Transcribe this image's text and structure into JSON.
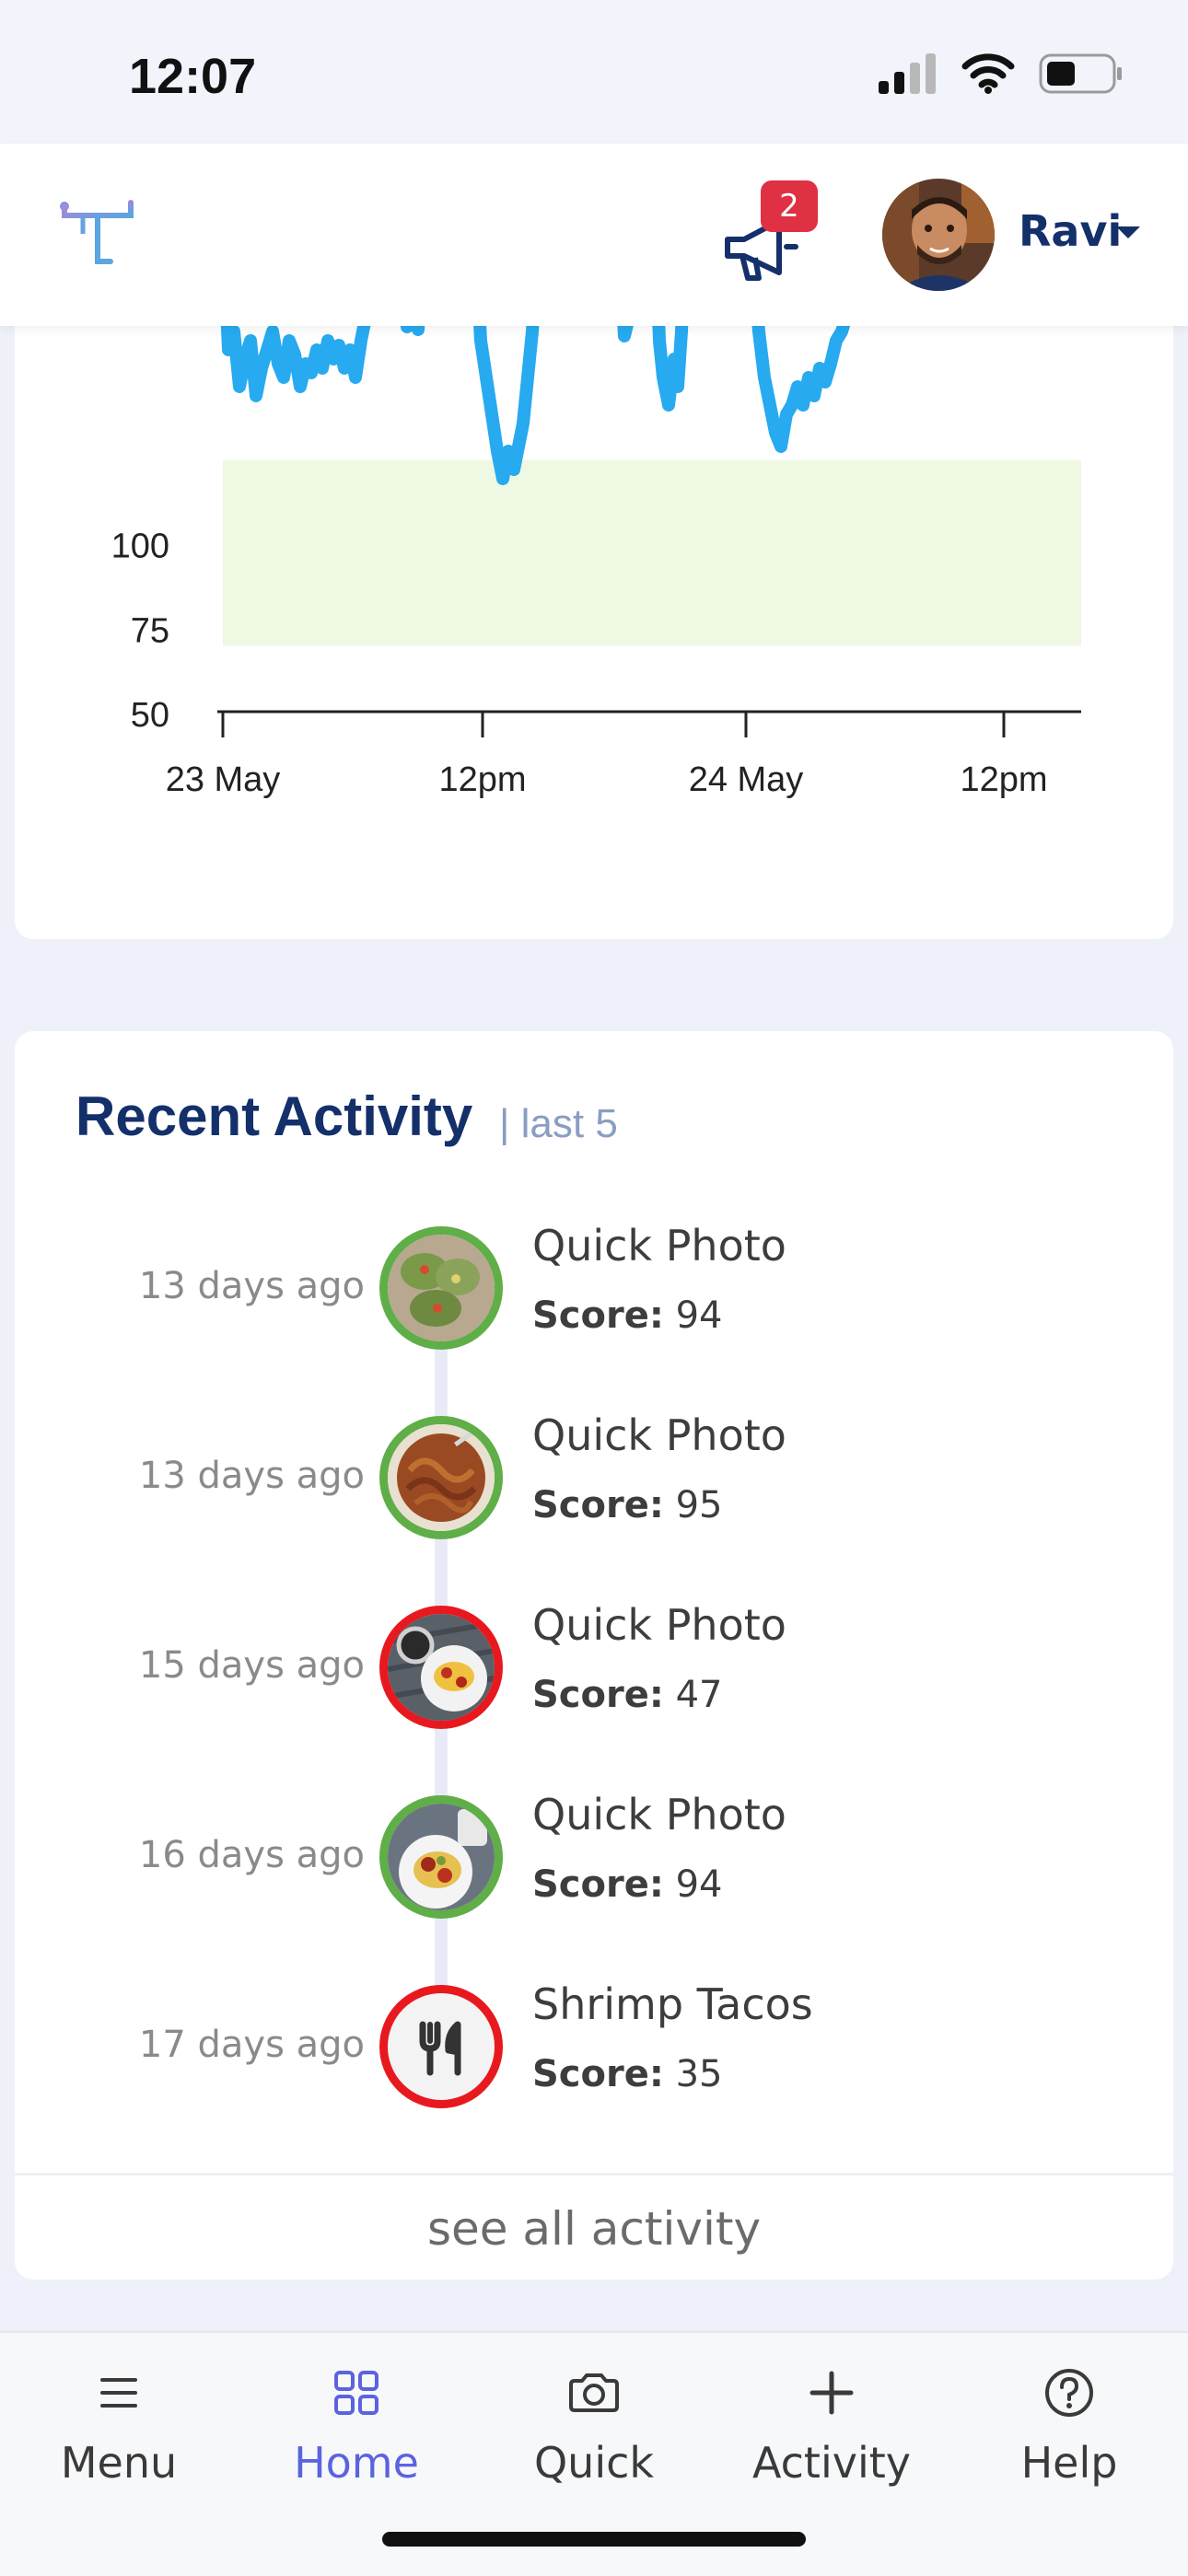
{
  "status_bar": {
    "time": "12:07"
  },
  "header": {
    "notification_count": "2",
    "user_name": "Ravi"
  },
  "chart_data": {
    "type": "line",
    "x_ticks": [
      "23 May",
      "12pm",
      "24 May",
      "12pm"
    ],
    "y_ticks": [
      "100",
      "75",
      "50"
    ],
    "target_range": [
      70,
      125
    ],
    "series_color": "#27aaf0",
    "band_color": "#eef8e2"
  },
  "activity": {
    "title": "Recent Activity",
    "subtitle": "| last 5",
    "score_label": "Score:",
    "items": [
      {
        "when": "13 days ago",
        "name": "Quick Photo",
        "score": "94",
        "status": "good",
        "thumb": "tacos-photo"
      },
      {
        "when": "13 days ago",
        "name": "Quick Photo",
        "score": "95",
        "status": "good",
        "thumb": "pasta-photo"
      },
      {
        "when": "15 days ago",
        "name": "Quick Photo",
        "score": "47",
        "status": "bad",
        "thumb": "breakfast-photo"
      },
      {
        "when": "16 days ago",
        "name": "Quick Photo",
        "score": "94",
        "status": "good",
        "thumb": "plate-photo"
      },
      {
        "when": "17 days ago",
        "name": "Shrimp Tacos",
        "score": "35",
        "status": "bad",
        "thumb": "fork-knife-icon"
      }
    ],
    "see_all": "see all activity"
  },
  "tabbar": {
    "menu": "Menu",
    "home": "Home",
    "quick": "Quick",
    "activity": "Activity",
    "help": "Help",
    "active": "home"
  },
  "colors": {
    "brand_navy": "#14306b",
    "good": "#5fae47",
    "bad": "#e8191e",
    "active_tab": "#5b63e0"
  }
}
